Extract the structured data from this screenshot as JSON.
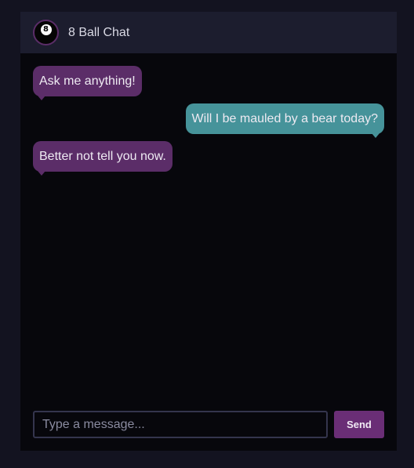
{
  "header": {
    "title": "8 Ball Chat",
    "avatar_glyph": "8",
    "avatar_icon": "eight-ball-icon"
  },
  "messages": [
    {
      "sender": "bot",
      "text": "Ask me anything!"
    },
    {
      "sender": "user",
      "text": "Will I be mauled by a bear today?"
    },
    {
      "sender": "bot",
      "text": "Better not tell you now."
    }
  ],
  "composer": {
    "placeholder": "Type a message...",
    "value": "",
    "send_label": "Send"
  },
  "colors": {
    "page_background": "#131320",
    "window_background": "#07070c",
    "header_background": "#1c1d2e",
    "bot_bubble": "#5b2d68",
    "user_bubble": "#46939a",
    "send_button": "#6a2e76",
    "input_border": "#34354d"
  }
}
